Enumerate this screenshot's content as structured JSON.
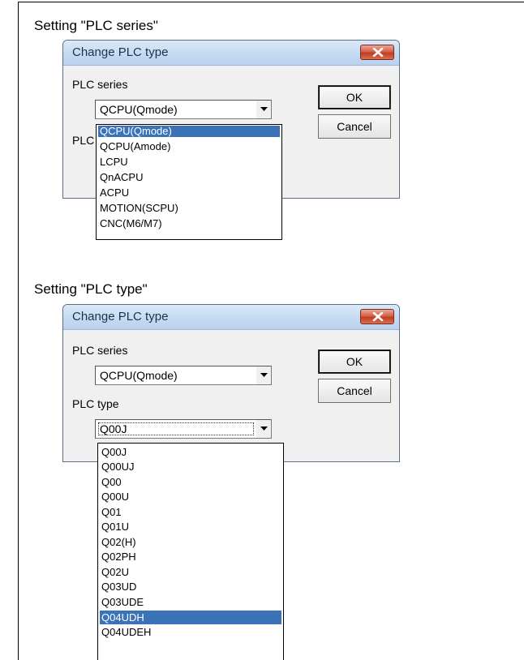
{
  "section1": {
    "heading": "Setting \"PLC series\"",
    "dialog": {
      "title": "Change PLC type",
      "series_label": "PLC series",
      "series_value": "QCPU(Qmode)",
      "type_label_partial": "PLC",
      "ok_label": "OK",
      "cancel_label": "Cancel",
      "options": [
        "QCPU(Qmode)",
        "QCPU(Amode)",
        "LCPU",
        "QnACPU",
        "ACPU",
        "MOTION(SCPU)",
        "CNC(M6/M7)"
      ],
      "selected_option": "QCPU(Qmode)"
    }
  },
  "section2": {
    "heading": "Setting \"PLC type\"",
    "dialog": {
      "title": "Change PLC type",
      "series_label": "PLC series",
      "series_value": "QCPU(Qmode)",
      "type_label": "PLC type",
      "type_value": "Q00J",
      "ok_label": "OK",
      "cancel_label": "Cancel",
      "options": [
        "Q00J",
        "Q00UJ",
        "Q00",
        "Q00U",
        "Q01",
        "Q01U",
        "Q02(H)",
        "Q02PH",
        "Q02U",
        "Q03UD",
        "Q03UDE",
        "Q04UDH",
        "Q04UDEH"
      ],
      "selected_option": "Q04UDH"
    }
  },
  "icons": {
    "close": "close-x-icon",
    "dropdown": "chevron-down-icon"
  },
  "colors": {
    "selection": "#3b73b9",
    "close_button": "#c23c22",
    "titlebar": "#c7dcf3"
  }
}
